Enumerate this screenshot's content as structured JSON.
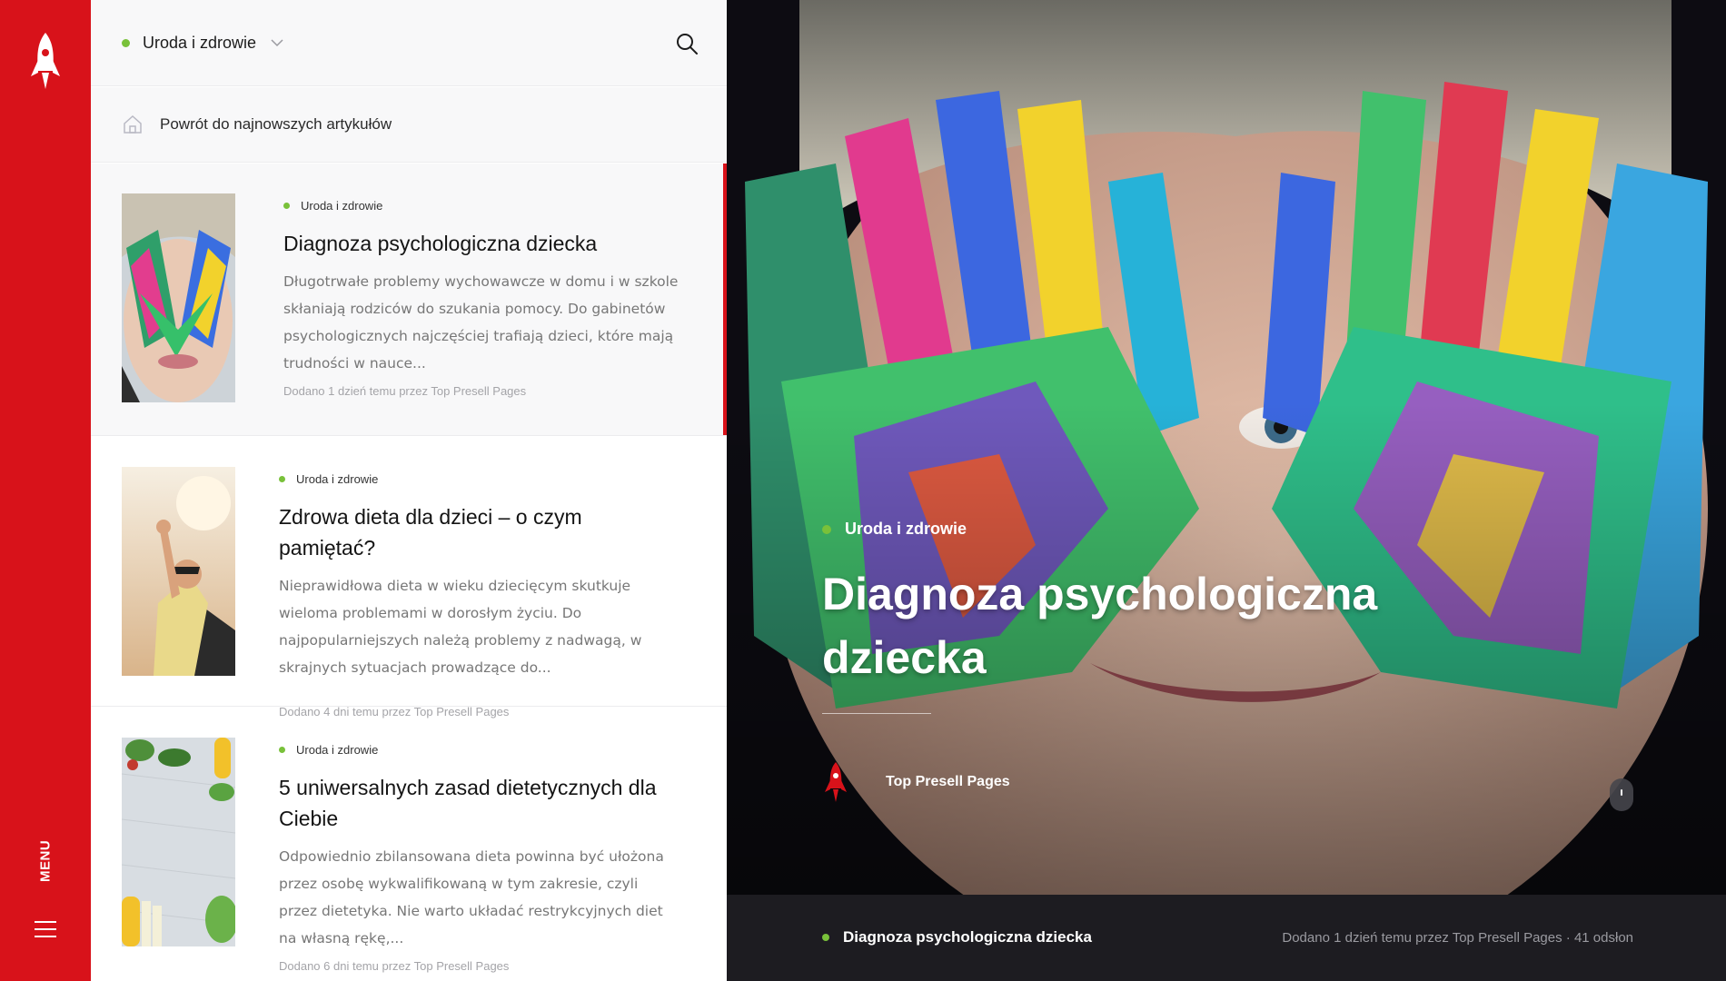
{
  "rail": {
    "logo_icon": "rocket-icon",
    "menu_label": "MENU",
    "hamburger_icon": "hamburger-icon"
  },
  "topbar": {
    "category_selected": "Uroda i zdrowie",
    "search_icon": "search-icon",
    "accent_color": "#79c13a"
  },
  "backbar": {
    "label": "Powrót do najnowszych artykułów",
    "icon": "home-icon"
  },
  "articles": [
    {
      "category": "Uroda i zdrowie",
      "title": "Diagnoza psychologiczna dziecka",
      "excerpt": "Długotrwałe problemy wychowawcze w domu i w szkole skłaniają rodziców do szukania pomocy. Do gabinetów psychologicznych najczęściej trafiają dzieci, które mają trudności w nauce...",
      "meta": "Dodano 1 dzień temu przez Top Presell Pages",
      "active": true
    },
    {
      "category": "Uroda i zdrowie",
      "title": "Zdrowa dieta dla dzieci – o czym pamiętać?",
      "excerpt": "Nieprawidłowa dieta w wieku dziecięcym skutkuje wieloma problemami w dorosłym życiu. Do najpopularniejszych należą problemy z nadwagą, w skrajnych sytuacjach prowadzące do...",
      "meta": "Dodano 4 dni temu przez Top Presell Pages",
      "active": false
    },
    {
      "category": "Uroda i zdrowie",
      "title": "5 uniwersalnych zasad dietetycznych dla Ciebie",
      "excerpt": "Odpowiednio zbilansowana dieta powinna być ułożona przez osobę wykwalifikowaną w tym zakresie, czyli przez dietetyka. Nie warto układać restrykcyjnych diet na własną rękę,...",
      "meta": "Dodano 6 dni temu przez Top Presell Pages",
      "active": false
    }
  ],
  "hero": {
    "category": "Uroda i zdrowie",
    "title": "Diagnoza psychologiczna dziecka",
    "author": "Top Presell Pages",
    "author_icon": "rocket-icon"
  },
  "footer": {
    "title": "Diagnoza psychologiczna dziecka",
    "meta": "Dodano 1 dzień temu przez Top Presell Pages · 41 odsłon"
  },
  "colors": {
    "brand_red": "#d8121a",
    "accent_green": "#79c13a",
    "footer_bg": "#1d1c21"
  }
}
